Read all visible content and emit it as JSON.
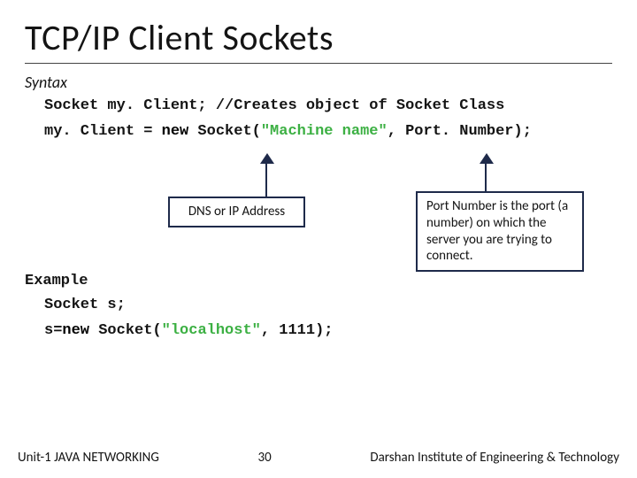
{
  "title": "TCP/IP Client Sockets",
  "syntax_label": "Syntax",
  "code": {
    "line1_pre": "Socket my. Client; ",
    "line1_comment": "//Creates object of Socket Class",
    "line2_a": "my. Client = ",
    "line2_new": "new",
    "line2_b": " Socket(",
    "line2_str": "\"Machine name\"",
    "line2_c": ", Port. Number);"
  },
  "callout1": "DNS or IP Address",
  "callout2": "Port Number is the port (a number) on which the server you are trying to connect.",
  "example_label": "Example",
  "example": {
    "line1": "Socket s;",
    "line2_a": "s=",
    "line2_new": "new",
    "line2_b": " Socket(",
    "line2_str": "\"localhost\"",
    "line2_c": ", 1111);"
  },
  "footer": {
    "left": "Unit-1 JAVA NETWORKING",
    "center": "30",
    "right": "Darshan Institute of Engineering & Technology"
  }
}
